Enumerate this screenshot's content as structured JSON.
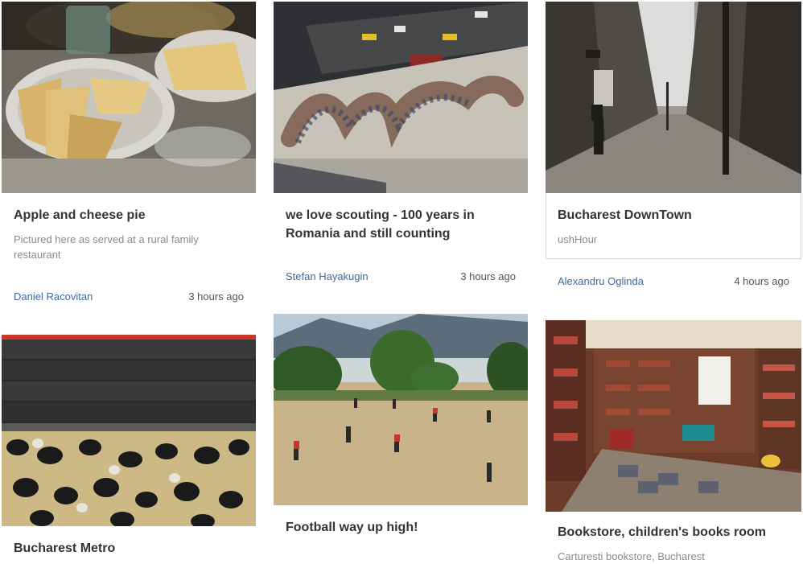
{
  "cards": [
    {
      "title": "Apple and cheese pie",
      "description": "Pictured here as served at a rural family restaurant",
      "author": "Daniel Racovitan",
      "time": "3 hours ago"
    },
    {
      "title": "we love scouting - 100 years in Romania and still counting",
      "author": "Stefan Hayakugin",
      "time": "3 hours ago"
    },
    {
      "title": "Bucharest DownTown",
      "description": "ushHour",
      "author": "Alexandru Oglinda",
      "time": "4 hours ago"
    },
    {
      "title": "Bucharest Metro"
    },
    {
      "title": "Football way up high!"
    },
    {
      "title": "Bookstore, children's books room",
      "description": "Carturesti bookstore, Bucharest"
    }
  ]
}
